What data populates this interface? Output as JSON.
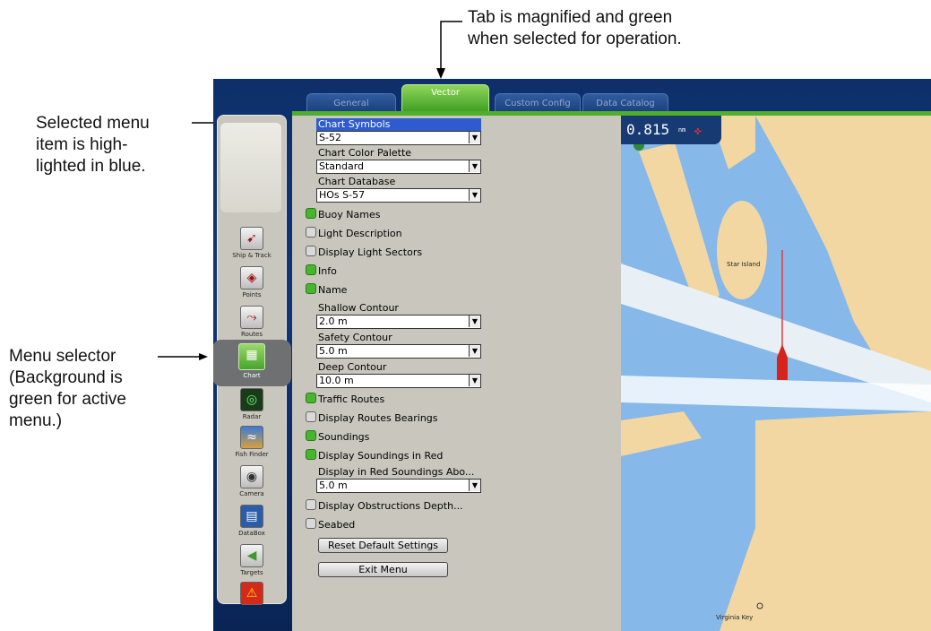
{
  "annotations": {
    "tab_note_line1": "Tab is magnified and green",
    "tab_note_line2": "when selected for operation.",
    "selected_note_line1": "Selected menu",
    "selected_note_line2": "item is high-",
    "selected_note_line3": "lighted in blue.",
    "selector_note_line1": "Menu selector",
    "selector_note_line2": "(Background is",
    "selector_note_line3": "green for active",
    "selector_note_line4": "menu.)"
  },
  "tabs": [
    {
      "label": "General",
      "active": false
    },
    {
      "label": "Vector",
      "active": true
    },
    {
      "label": "Custom Config",
      "active": false
    },
    {
      "label": "Data Catalog",
      "active": false
    }
  ],
  "sidebar": {
    "items": [
      {
        "label": "Ship & Track",
        "icon": "ship-track-icon"
      },
      {
        "label": "Points",
        "icon": "points-icon"
      },
      {
        "label": "Routes",
        "icon": "routes-icon"
      },
      {
        "label": "Chart",
        "icon": "chart-icon",
        "active": true
      },
      {
        "label": "Radar",
        "icon": "radar-icon"
      },
      {
        "label": "Fish Finder",
        "icon": "fish-finder-icon"
      },
      {
        "label": "Camera",
        "icon": "camera-icon"
      },
      {
        "label": "DataBox",
        "icon": "databox-icon"
      },
      {
        "label": "Targets",
        "icon": "targets-icon"
      },
      {
        "label": "",
        "icon": "alarm-icon"
      }
    ]
  },
  "menu": {
    "chart_symbols": {
      "label": "Chart Symbols",
      "value": "S-52"
    },
    "chart_color_palette": {
      "label": "Chart Color Palette",
      "value": "Standard"
    },
    "chart_database": {
      "label": "Chart Database",
      "value": "HOs S-57"
    },
    "buoy_names": {
      "label": "Buoy Names",
      "checked": true
    },
    "light_description": {
      "label": "Light Description",
      "checked": false
    },
    "display_light_sectors": {
      "label": "Display Light Sectors",
      "checked": false
    },
    "info": {
      "label": "Info",
      "checked": true
    },
    "name": {
      "label": "Name",
      "checked": true
    },
    "shallow_contour": {
      "label": "Shallow Contour",
      "value": "2.0 m"
    },
    "safety_contour": {
      "label": "Safety Contour",
      "value": "5.0 m"
    },
    "deep_contour": {
      "label": "Deep Contour",
      "value": "10.0 m"
    },
    "traffic_routes": {
      "label": "Traffic Routes",
      "checked": true
    },
    "display_routes_bearings": {
      "label": "Display Routes Bearings",
      "checked": false
    },
    "soundings": {
      "label": "Soundings",
      "checked": true
    },
    "display_soundings_red": {
      "label": "Display Soundings in Red",
      "checked": true
    },
    "red_soundings_above": {
      "label": "Display in Red Soundings Abo...",
      "value": "5.0 m"
    },
    "display_obstructions": {
      "label": "Display Obstructions Depth...",
      "checked": false
    },
    "seabed": {
      "label": "Seabed",
      "checked": false
    },
    "reset_button": "Reset Default Settings",
    "exit_button": "Exit Menu"
  },
  "chart_view": {
    "scale": "0.815",
    "scale_unit": "nm",
    "label_star_island": "Star Island",
    "label_virginia_key": "Virginia Key"
  },
  "colors": {
    "active_tab": "#4fae2c",
    "highlight": "#2e5cd0",
    "water": "#7fb2e6",
    "land": "#f2d7a3"
  }
}
